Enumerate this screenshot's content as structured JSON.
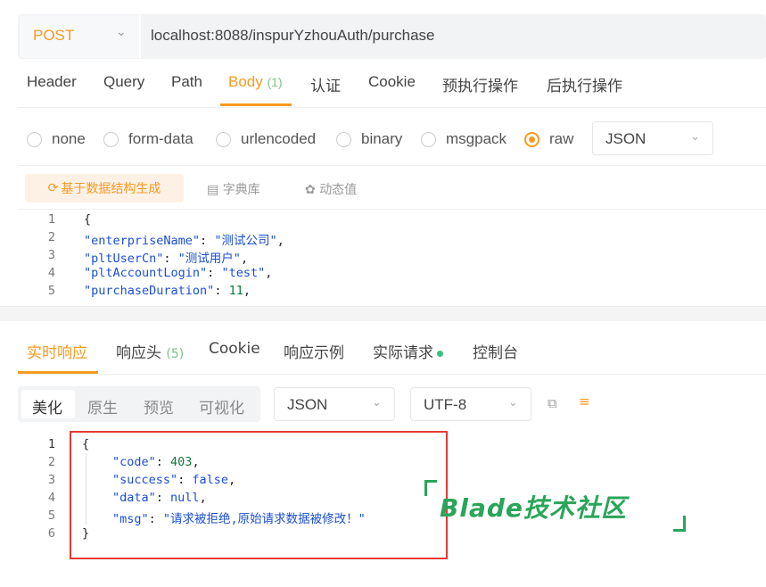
{
  "request": {
    "method": "POST",
    "url": "localhost:8088/inspurYzhouAuth/purchase",
    "tabs": [
      {
        "label": "Header"
      },
      {
        "label": "Query"
      },
      {
        "label": "Path"
      },
      {
        "label": "Body",
        "count": "(1)"
      },
      {
        "label": "认证"
      },
      {
        "label": "Cookie"
      },
      {
        "label": "预执行操作"
      },
      {
        "label": "后执行操作"
      }
    ],
    "body_types": [
      "none",
      "form-data",
      "urlencoded",
      "binary",
      "msgpack",
      "raw"
    ],
    "selected_body_type": "raw",
    "raw_format": "JSON",
    "toolbar": {
      "generate": "基于数据结构生成",
      "dictionary": "字典库",
      "dynamic": "动态值"
    },
    "code_lines": [
      {
        "num": "1",
        "text": "{"
      },
      {
        "num": "2",
        "key": "\"enterpriseName\"",
        "value": "\"测试公司\""
      },
      {
        "num": "3",
        "key": "\"pltUserCn\"",
        "value": "\"测试用户\""
      },
      {
        "num": "4",
        "key": "\"pltAccountLogin\"",
        "value": "\"test\""
      },
      {
        "num": "5",
        "key": "\"purchaseDuration\"",
        "value": "11"
      }
    ]
  },
  "response": {
    "tabs": [
      {
        "label": "实时响应"
      },
      {
        "label": "响应头",
        "count": "(5)"
      },
      {
        "label": "Cookie"
      },
      {
        "label": "响应示例"
      },
      {
        "label": "实际请求"
      },
      {
        "label": "控制台"
      }
    ],
    "view_modes": [
      "美化",
      "原生",
      "预览",
      "可视化"
    ],
    "format": "JSON",
    "encoding": "UTF-8",
    "code_lines": [
      {
        "num": "1",
        "text": "{"
      },
      {
        "num": "2",
        "key": "\"code\"",
        "value": "403",
        "comma": ","
      },
      {
        "num": "3",
        "key": "\"success\"",
        "value": "false",
        "comma": ","
      },
      {
        "num": "4",
        "key": "\"data\"",
        "value": "null",
        "comma": ","
      },
      {
        "num": "5",
        "key": "\"msg\"",
        "value": "\"请求被拒绝,原始请求数据被修改！\"",
        "comma": ""
      },
      {
        "num": "6",
        "text": "}"
      }
    ]
  },
  "watermark": "Blade技术社区",
  "colors": {
    "accent": "#f59a23",
    "highlight_border": "#e53935",
    "watermark": "#29a55a",
    "json_key": "#1a4fd2",
    "json_number": "#117a3a"
  }
}
